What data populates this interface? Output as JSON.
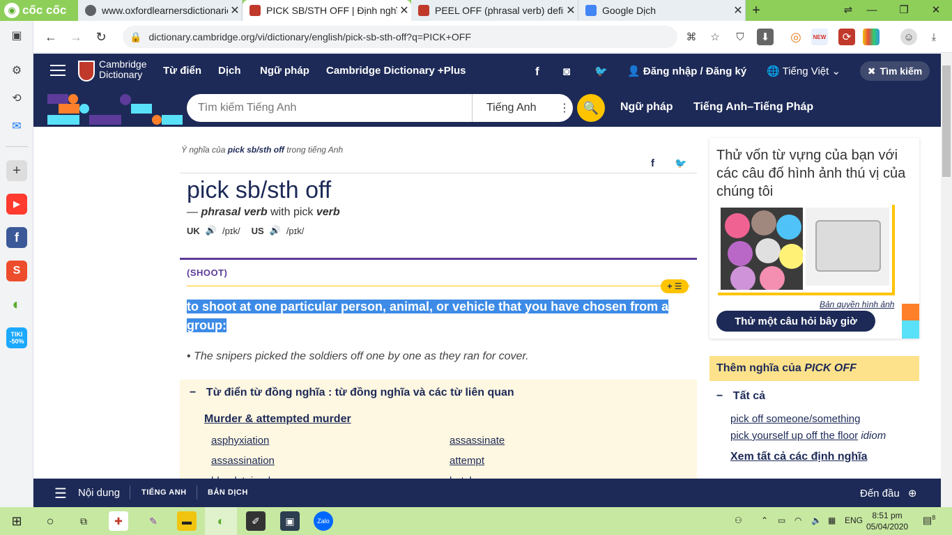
{
  "browser": {
    "brand": "cốc cốc",
    "tabs": [
      {
        "title": "www.oxfordlearnersdictionaries",
        "favicon_color": "#5f6368"
      },
      {
        "title": "PICK SB/STH OFF | Định nghĩa",
        "favicon_color": "#c0392b"
      },
      {
        "title": "PEEL OFF (phrasal verb) definiti",
        "favicon_color": "#c0392b"
      },
      {
        "title": "Google Dịch",
        "favicon_color": "#4285f4"
      }
    ],
    "new_tab": "+",
    "url": "dictionary.cambridge.org/vi/dictionary/english/pick-sb-sth-off?q=PICK+OFF",
    "new_badge": "NEW"
  },
  "left_sidebar": {
    "tiles": [
      {
        "name": "youtube",
        "label": "▶",
        "color": "#ff3b30"
      },
      {
        "name": "facebook",
        "label": "f",
        "color": "#3b5998"
      },
      {
        "name": "shopee",
        "label": "S",
        "color": "#ee4d2d"
      },
      {
        "name": "tiki",
        "label": "TIKI -50%",
        "color": "#1ba8ff"
      }
    ]
  },
  "cambridge": {
    "logo_line1": "Cambridge",
    "logo_line2": "Dictionary",
    "nav": [
      "Từ điển",
      "Dịch",
      "Ngữ pháp",
      "Cambridge Dictionary +Plus"
    ],
    "login": "Đăng nhập / Đăng ký",
    "language": "Tiếng Việt",
    "search_button": "Tìm kiếm",
    "search_placeholder": "Tìm kiếm Tiếng Anh",
    "search_lang": "Tiếng Anh",
    "band_links": [
      "Ngữ pháp",
      "Tiếng Anh–Tiếng Pháp"
    ]
  },
  "entry": {
    "breadcrumb_prefix": "Ý nghĩa của",
    "breadcrumb_word": "pick sb/sth off",
    "breadcrumb_suffix": "trong tiếng Anh",
    "headword": "pick sb/sth off",
    "pos_dash": "—",
    "pos": "phrasal verb",
    "pos_with": "with pick",
    "pos_verb": "verb",
    "uk_label": "UK",
    "uk_ipa": "/pɪk/",
    "us_label": "US",
    "us_ipa": "/pɪk/",
    "guideword": "(SHOOT)",
    "add_list": "+ ☰",
    "definition": "to shoot at one particular person, animal, or vehicle that you have chosen from a group:",
    "example": "The snipers picked the soldiers off one by one as they ran for cover.",
    "thesaurus_title": "Từ điển từ đồng nghĩa : từ đồng nghĩa và các từ liên quan",
    "thesaurus_toggle": "−",
    "thesaurus_category": "Murder & attempted murder",
    "thesaurus_col1": [
      "asphyxiation",
      "assassination",
      "bloodstained"
    ],
    "thesaurus_col2": [
      "assassinate",
      "attempt",
      "butcher"
    ]
  },
  "sidebar": {
    "quiz_title": "Thử vốn từ vựng của bạn với các câu đố hình ảnh thú vị của chúng tôi",
    "copyright": "Bản quyền hình ảnh",
    "quiz_button": "Thử một câu hỏi bây giờ",
    "more_prefix": "Thêm nghĩa của",
    "more_word": "PICK OFF",
    "all_label": "Tất cả",
    "all_toggle": "−",
    "links": [
      {
        "text": "pick off someone/something",
        "tag": ""
      },
      {
        "text": "pick yourself up off the floor",
        "tag": "idiom"
      }
    ],
    "see_all": "Xem tất cả các định nghĩa"
  },
  "bottom": {
    "contents": "Nội dung",
    "tab1": "TIẾNG ANH",
    "tab2": "BẢN DỊCH",
    "to_top": "Đến đầu"
  },
  "taskbar": {
    "lang": "ENG",
    "time": "8:51 pm",
    "date": "05/04/2020",
    "notif_count": "8"
  },
  "colors": {
    "navy": "#1d2a57",
    "yellow": "#fec400",
    "purple": "#5c3b9a",
    "highlight": "#3d8be6",
    "taskbar": "#c7e8a1",
    "tabbar": "#8ecf5a"
  }
}
